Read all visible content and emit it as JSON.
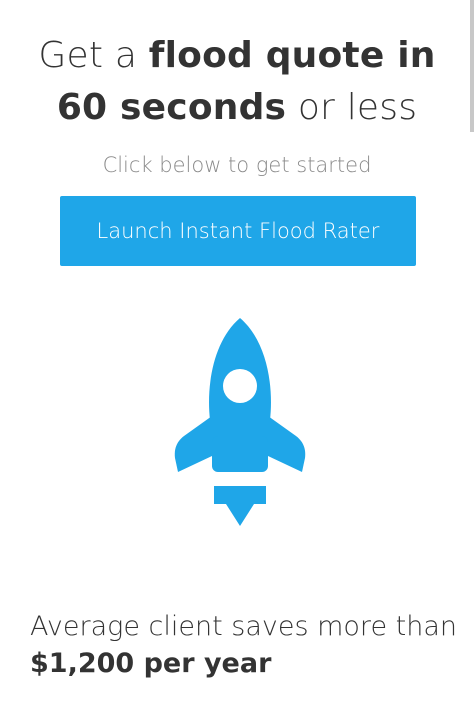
{
  "headline": {
    "part1": "Get a ",
    "bold1": "flood quote in",
    "bold2": "60 seconds",
    "part2": " or less"
  },
  "subtext": "Click below to get started",
  "launch_button": {
    "label": "Launch Instant Flood Rater"
  },
  "rocket": {
    "icon": "rocket-icon",
    "color": "#1fa6e8"
  },
  "savings": {
    "prefix": "Average client saves more than ",
    "amount": "$1,200 per year"
  },
  "colors": {
    "accent": "#1fa6e8",
    "text": "#333333",
    "muted": "#8a8a8a"
  }
}
